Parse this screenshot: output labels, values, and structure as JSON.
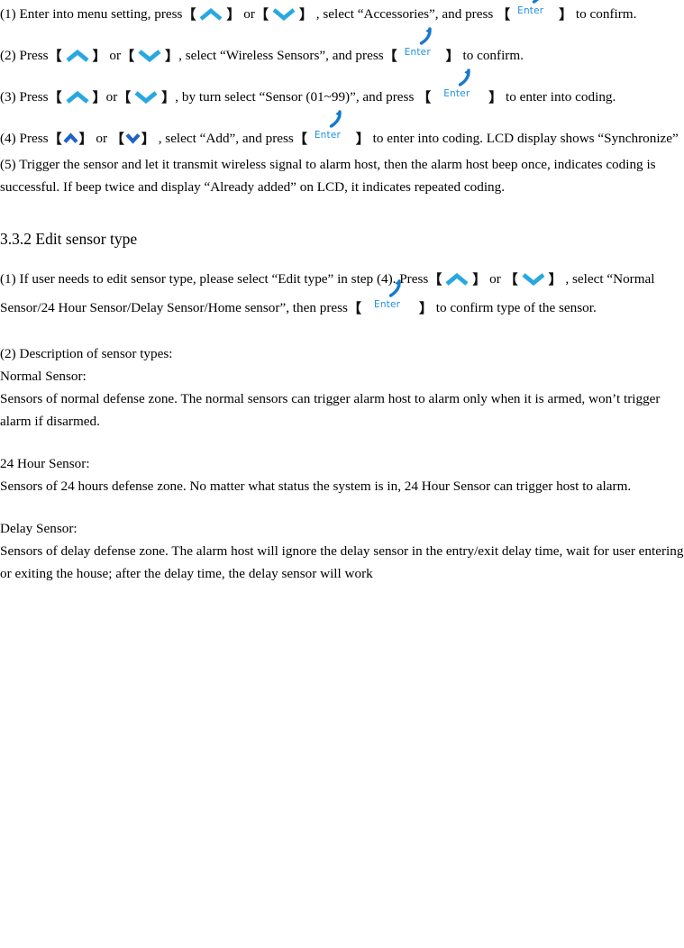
{
  "document": {
    "type": "user-manual-page",
    "colors": {
      "text": "#000000",
      "chevron_light": "#29a8e0",
      "chevron_dark": "#1f63c8",
      "enter_blue": "#1e90e0",
      "bracket": "#101010",
      "background": "#ffffff"
    },
    "icons": {
      "up_chevron": "chevron-up-icon",
      "down_chevron": "chevron-down-icon",
      "enter_key": "enter-key-icon",
      "return_arrow": "return-arrow-icon"
    }
  },
  "steps_coding": {
    "step1": {
      "prefix": "(1) Enter into menu setting, press",
      "mid1": "or",
      "mid2": ", select “Accessories”, and press",
      "suffix": "to confirm.",
      "enter_label": "Enter"
    },
    "step2": {
      "prefix": "(2) Press",
      "mid1": "or",
      "mid2": ",  select “Wireless Sensors”, and press",
      "suffix": "to confirm.",
      "enter_label": "Enter"
    },
    "step3": {
      "prefix": "(3) Press",
      "mid1": "or",
      "mid2": ", by turn select “Sensor (01~99)”, and press",
      "suffix": "to enter into coding.",
      "enter_label": "Enter"
    },
    "step4": {
      "prefix": "(4) Press",
      "mid1": "or",
      "mid2": ", select “Add”, and press",
      "suffix": "to enter into coding. LCD display shows “Synchronize”",
      "enter_label": "Enter"
    },
    "step5": {
      "text": "(5) Trigger the sensor and let it transmit wireless signal to alarm host, then the alarm host beep once, indicates coding is successful. If beep twice and display “Already added” on LCD, it indicates repeated coding."
    }
  },
  "section": {
    "heading": "3.3.2 Edit sensor type",
    "item1": {
      "prefix": "(1) If user needs to edit sensor type, please select “Edit type” in step (4). Press",
      "mid1": "or",
      "mid2": ", select “Normal Sensor/24 Hour Sensor/Delay Sensor/Home sensor”, then press",
      "suffix": "to confirm type of the sensor.",
      "enter_label": "Enter"
    },
    "item2": {
      "intro": "(2) Description of sensor types:",
      "types": [
        {
          "title": "Normal Sensor:",
          "description": "Sensors of normal defense zone. The normal sensors can trigger alarm host to alarm only when it is armed, won’t trigger alarm if disarmed."
        },
        {
          "title": "24 Hour Sensor:",
          "description": "Sensors of 24 hours defense zone. No matter what status the system is in, 24 Hour Sensor can trigger host to alarm."
        },
        {
          "title": "Delay Sensor:",
          "description": "Sensors of delay defense zone. The alarm host will ignore the delay sensor in the entry/exit delay time, wait for user entering or exiting the house; after the delay time, the delay sensor will work"
        }
      ]
    }
  }
}
